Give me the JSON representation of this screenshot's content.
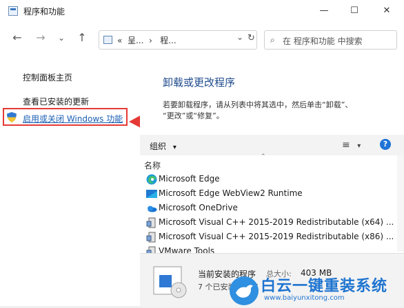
{
  "window": {
    "title": "程序和功能",
    "minimize_glyph": "—",
    "maximize_glyph": "☐",
    "close_glyph": "✕"
  },
  "nav": {
    "back_glyph": "←",
    "forward_glyph": "→",
    "dropdown_glyph": "⌄",
    "up_glyph": "↑",
    "address_text": "«  呈...  ›   程...",
    "address_dropdown_glyph": "⌄",
    "refresh_glyph": "↻",
    "search_placeholder": "在 程序和功能 中搜索",
    "search_glyph": "⌕"
  },
  "sidebar": {
    "home_link": "控制面板主页",
    "updates_link": "查看已安装的更新",
    "features_link": "启用或关闭 Windows 功能"
  },
  "main": {
    "heading": "卸载或更改程序",
    "description_line1": "若要卸载程序，请从列表中将其选中，然后单击“卸载”、",
    "description_line2": "“更改”或“修复”。"
  },
  "toolbar": {
    "organize_label": "组织",
    "organize_dropdown_glyph": "▾",
    "view_glyph": "≡",
    "view_dropdown_glyph": "▾",
    "help_glyph": "?"
  },
  "list": {
    "column_name": "名称",
    "sort_glyph": "⌃",
    "programs": [
      {
        "name": "Microsoft Edge",
        "icon": "edge-icon"
      },
      {
        "name": "Microsoft Edge WebView2 Runtime",
        "icon": "webview-icon"
      },
      {
        "name": "Microsoft OneDrive",
        "icon": "onedrive-icon"
      },
      {
        "name": "Microsoft Visual C++ 2015-2019 Redistributable (x64) ...",
        "icon": "installer-icon"
      },
      {
        "name": "Microsoft Visual C++ 2015-2019 Redistributable (x86) ...",
        "icon": "installer-icon"
      },
      {
        "name": "VMware Tools",
        "icon": "installer-icon"
      }
    ]
  },
  "status": {
    "title": "当前安装的程序",
    "size_label": "总大小:",
    "size_value": "403 MB",
    "count_text": "7 个已安装的程序"
  },
  "watermark": {
    "brand": "白云一键重装系统",
    "url": "www.baiyunxitong.com"
  },
  "colors": {
    "link": "#1a5fb4",
    "heading": "#1e4a8c",
    "highlight": "#e53935",
    "watermark": "#1f74d0"
  }
}
